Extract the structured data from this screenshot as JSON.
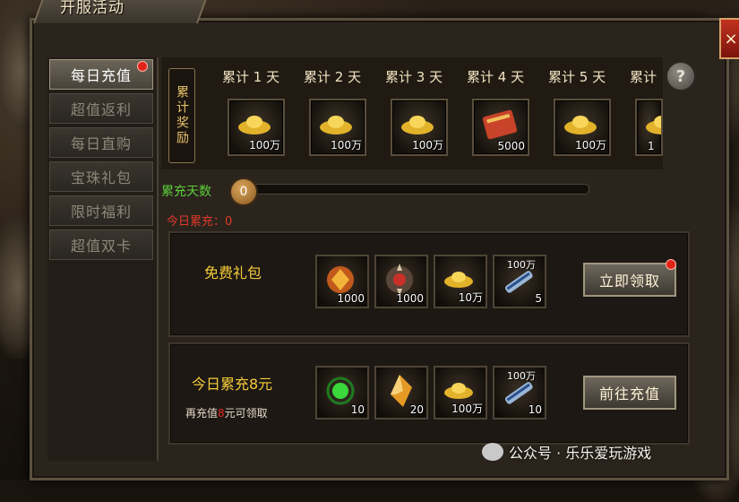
{
  "window": {
    "title": "开服活动",
    "close_label": "×"
  },
  "sidebar": {
    "items": [
      {
        "label": "每日充值"
      },
      {
        "label": "超值返利"
      },
      {
        "label": "每日直购"
      },
      {
        "label": "宝珠礼包"
      },
      {
        "label": "限时福利"
      },
      {
        "label": "超值双卡"
      }
    ]
  },
  "rewards": {
    "vertical_label": "累计奖励",
    "help_label": "?",
    "days": [
      {
        "label": "累计 1 天",
        "icon": "gold-ingot-icon",
        "qty": "100万"
      },
      {
        "label": "累计 2 天",
        "icon": "gold-ingot-icon",
        "qty": "100万"
      },
      {
        "label": "累计 3 天",
        "icon": "gold-ingot-icon",
        "qty": "100万"
      },
      {
        "label": "累计 4 天",
        "icon": "red-book-icon",
        "qty": "5000"
      },
      {
        "label": "累计 5 天",
        "icon": "gold-ingot-icon",
        "qty": "100万"
      },
      {
        "label": "累计",
        "icon": "gold-ingot-icon",
        "qty": "1"
      }
    ]
  },
  "progress": {
    "label": "累充天数",
    "value": 0,
    "today_label": "今日累充：0"
  },
  "rows": [
    {
      "title": "免费礼包",
      "sub_prefix": "",
      "sub_highlight": "",
      "sub_suffix": "",
      "button": "立即领取",
      "items": [
        {
          "icon": "gold-gem-icon",
          "qty": "1000",
          "top": ""
        },
        {
          "icon": "skull-orb-icon",
          "qty": "1000",
          "top": ""
        },
        {
          "icon": "gold-ingot-icon",
          "qty": "10万",
          "top": ""
        },
        {
          "icon": "scroll-icon",
          "qty": "5",
          "top": "100万"
        }
      ]
    },
    {
      "title": "今日累充8元",
      "sub_prefix": "再充值",
      "sub_highlight": "8",
      "sub_suffix": "元可领取",
      "button": "前往充值",
      "items": [
        {
          "icon": "green-orb-icon",
          "qty": "10",
          "top": ""
        },
        {
          "icon": "amber-crystal-icon",
          "qty": "20",
          "top": ""
        },
        {
          "icon": "gold-ingot-icon",
          "qty": "100万",
          "top": ""
        },
        {
          "icon": "scroll-icon",
          "qty": "10",
          "top": "100万"
        }
      ]
    }
  ],
  "watermark": "公众号 · 乐乐爱玩游戏",
  "colors": {
    "accent_gold": "#f5cb3a",
    "progress_green": "#5ccd3a",
    "alert_red": "#e03a2a"
  }
}
